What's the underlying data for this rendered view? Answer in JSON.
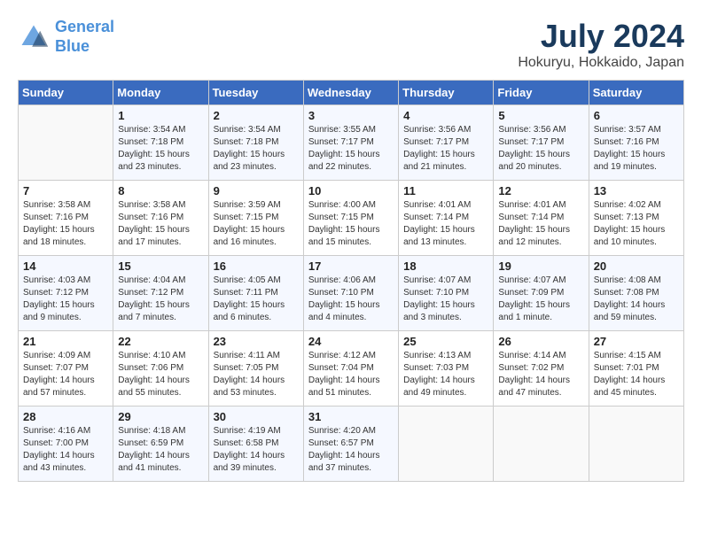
{
  "header": {
    "logo_line1": "General",
    "logo_line2": "Blue",
    "month_year": "July 2024",
    "location": "Hokuryu, Hokkaido, Japan"
  },
  "weekdays": [
    "Sunday",
    "Monday",
    "Tuesday",
    "Wednesday",
    "Thursday",
    "Friday",
    "Saturday"
  ],
  "weeks": [
    [
      {
        "day": "",
        "sunrise": "",
        "sunset": "",
        "daylight": ""
      },
      {
        "day": "1",
        "sunrise": "Sunrise: 3:54 AM",
        "sunset": "Sunset: 7:18 PM",
        "daylight": "Daylight: 15 hours and 23 minutes."
      },
      {
        "day": "2",
        "sunrise": "Sunrise: 3:54 AM",
        "sunset": "Sunset: 7:18 PM",
        "daylight": "Daylight: 15 hours and 23 minutes."
      },
      {
        "day": "3",
        "sunrise": "Sunrise: 3:55 AM",
        "sunset": "Sunset: 7:17 PM",
        "daylight": "Daylight: 15 hours and 22 minutes."
      },
      {
        "day": "4",
        "sunrise": "Sunrise: 3:56 AM",
        "sunset": "Sunset: 7:17 PM",
        "daylight": "Daylight: 15 hours and 21 minutes."
      },
      {
        "day": "5",
        "sunrise": "Sunrise: 3:56 AM",
        "sunset": "Sunset: 7:17 PM",
        "daylight": "Daylight: 15 hours and 20 minutes."
      },
      {
        "day": "6",
        "sunrise": "Sunrise: 3:57 AM",
        "sunset": "Sunset: 7:16 PM",
        "daylight": "Daylight: 15 hours and 19 minutes."
      }
    ],
    [
      {
        "day": "7",
        "sunrise": "Sunrise: 3:58 AM",
        "sunset": "Sunset: 7:16 PM",
        "daylight": "Daylight: 15 hours and 18 minutes."
      },
      {
        "day": "8",
        "sunrise": "Sunrise: 3:58 AM",
        "sunset": "Sunset: 7:16 PM",
        "daylight": "Daylight: 15 hours and 17 minutes."
      },
      {
        "day": "9",
        "sunrise": "Sunrise: 3:59 AM",
        "sunset": "Sunset: 7:15 PM",
        "daylight": "Daylight: 15 hours and 16 minutes."
      },
      {
        "day": "10",
        "sunrise": "Sunrise: 4:00 AM",
        "sunset": "Sunset: 7:15 PM",
        "daylight": "Daylight: 15 hours and 15 minutes."
      },
      {
        "day": "11",
        "sunrise": "Sunrise: 4:01 AM",
        "sunset": "Sunset: 7:14 PM",
        "daylight": "Daylight: 15 hours and 13 minutes."
      },
      {
        "day": "12",
        "sunrise": "Sunrise: 4:01 AM",
        "sunset": "Sunset: 7:14 PM",
        "daylight": "Daylight: 15 hours and 12 minutes."
      },
      {
        "day": "13",
        "sunrise": "Sunrise: 4:02 AM",
        "sunset": "Sunset: 7:13 PM",
        "daylight": "Daylight: 15 hours and 10 minutes."
      }
    ],
    [
      {
        "day": "14",
        "sunrise": "Sunrise: 4:03 AM",
        "sunset": "Sunset: 7:12 PM",
        "daylight": "Daylight: 15 hours and 9 minutes."
      },
      {
        "day": "15",
        "sunrise": "Sunrise: 4:04 AM",
        "sunset": "Sunset: 7:12 PM",
        "daylight": "Daylight: 15 hours and 7 minutes."
      },
      {
        "day": "16",
        "sunrise": "Sunrise: 4:05 AM",
        "sunset": "Sunset: 7:11 PM",
        "daylight": "Daylight: 15 hours and 6 minutes."
      },
      {
        "day": "17",
        "sunrise": "Sunrise: 4:06 AM",
        "sunset": "Sunset: 7:10 PM",
        "daylight": "Daylight: 15 hours and 4 minutes."
      },
      {
        "day": "18",
        "sunrise": "Sunrise: 4:07 AM",
        "sunset": "Sunset: 7:10 PM",
        "daylight": "Daylight: 15 hours and 3 minutes."
      },
      {
        "day": "19",
        "sunrise": "Sunrise: 4:07 AM",
        "sunset": "Sunset: 7:09 PM",
        "daylight": "Daylight: 15 hours and 1 minute."
      },
      {
        "day": "20",
        "sunrise": "Sunrise: 4:08 AM",
        "sunset": "Sunset: 7:08 PM",
        "daylight": "Daylight: 14 hours and 59 minutes."
      }
    ],
    [
      {
        "day": "21",
        "sunrise": "Sunrise: 4:09 AM",
        "sunset": "Sunset: 7:07 PM",
        "daylight": "Daylight: 14 hours and 57 minutes."
      },
      {
        "day": "22",
        "sunrise": "Sunrise: 4:10 AM",
        "sunset": "Sunset: 7:06 PM",
        "daylight": "Daylight: 14 hours and 55 minutes."
      },
      {
        "day": "23",
        "sunrise": "Sunrise: 4:11 AM",
        "sunset": "Sunset: 7:05 PM",
        "daylight": "Daylight: 14 hours and 53 minutes."
      },
      {
        "day": "24",
        "sunrise": "Sunrise: 4:12 AM",
        "sunset": "Sunset: 7:04 PM",
        "daylight": "Daylight: 14 hours and 51 minutes."
      },
      {
        "day": "25",
        "sunrise": "Sunrise: 4:13 AM",
        "sunset": "Sunset: 7:03 PM",
        "daylight": "Daylight: 14 hours and 49 minutes."
      },
      {
        "day": "26",
        "sunrise": "Sunrise: 4:14 AM",
        "sunset": "Sunset: 7:02 PM",
        "daylight": "Daylight: 14 hours and 47 minutes."
      },
      {
        "day": "27",
        "sunrise": "Sunrise: 4:15 AM",
        "sunset": "Sunset: 7:01 PM",
        "daylight": "Daylight: 14 hours and 45 minutes."
      }
    ],
    [
      {
        "day": "28",
        "sunrise": "Sunrise: 4:16 AM",
        "sunset": "Sunset: 7:00 PM",
        "daylight": "Daylight: 14 hours and 43 minutes."
      },
      {
        "day": "29",
        "sunrise": "Sunrise: 4:18 AM",
        "sunset": "Sunset: 6:59 PM",
        "daylight": "Daylight: 14 hours and 41 minutes."
      },
      {
        "day": "30",
        "sunrise": "Sunrise: 4:19 AM",
        "sunset": "Sunset: 6:58 PM",
        "daylight": "Daylight: 14 hours and 39 minutes."
      },
      {
        "day": "31",
        "sunrise": "Sunrise: 4:20 AM",
        "sunset": "Sunset: 6:57 PM",
        "daylight": "Daylight: 14 hours and 37 minutes."
      },
      {
        "day": "",
        "sunrise": "",
        "sunset": "",
        "daylight": ""
      },
      {
        "day": "",
        "sunrise": "",
        "sunset": "",
        "daylight": ""
      },
      {
        "day": "",
        "sunrise": "",
        "sunset": "",
        "daylight": ""
      }
    ]
  ]
}
